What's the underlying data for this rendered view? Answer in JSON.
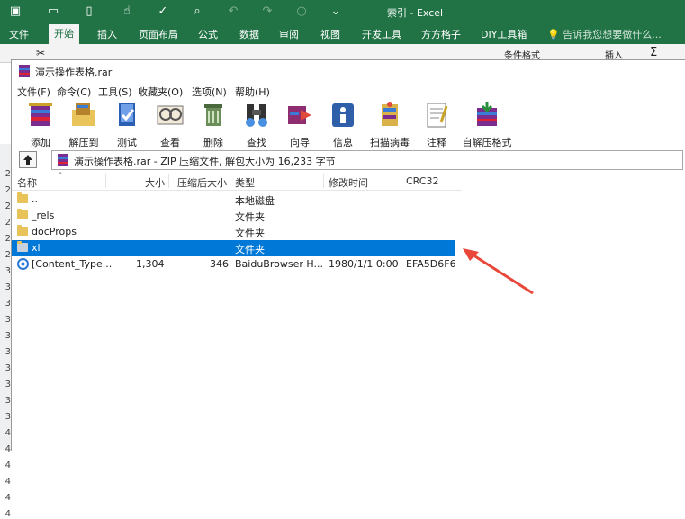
{
  "excel": {
    "title": "索引 - Excel",
    "tabs": [
      "文件",
      "开始",
      "插入",
      "页面布局",
      "公式",
      "数据",
      "审阅",
      "视图",
      "开发工具",
      "方方格子",
      "DIY工具箱"
    ],
    "active_tab": "开始",
    "search_hint": "告诉我您想要做什么...",
    "ribbon_items": [
      "条件格式",
      "插入"
    ],
    "row_numbers": [
      "2",
      "2",
      "2",
      "2",
      "2",
      "2",
      "3",
      "3",
      "3",
      "3",
      "3",
      "3",
      "3",
      "3",
      "3",
      "3",
      "4",
      "4",
      "4",
      "4",
      "4",
      "4"
    ]
  },
  "rar": {
    "title": "演示操作表格.rar",
    "menu": [
      "文件(F)",
      "命令(C)",
      "工具(S)",
      "收藏夹(O)",
      "选项(N)",
      "帮助(H)"
    ],
    "toolbar": [
      {
        "label": "添加",
        "icon": "add-icon"
      },
      {
        "label": "解压到",
        "icon": "extract-icon"
      },
      {
        "label": "测试",
        "icon": "test-icon"
      },
      {
        "label": "查看",
        "icon": "view-icon"
      },
      {
        "label": "删除",
        "icon": "delete-icon"
      },
      {
        "label": "查找",
        "icon": "find-icon"
      },
      {
        "label": "向导",
        "icon": "wizard-icon"
      },
      {
        "label": "信息",
        "icon": "info-icon"
      },
      {
        "label": "扫描病毒",
        "icon": "virus-scan-icon"
      },
      {
        "label": "注释",
        "icon": "comment-icon"
      },
      {
        "label": "自解压格式",
        "icon": "sfx-icon"
      }
    ],
    "address": "演示操作表格.rar - ZIP 压缩文件, 解包大小为 16,233 字节",
    "columns": [
      "名称",
      "大小",
      "压缩后大小",
      "类型",
      "修改时间",
      "CRC32"
    ],
    "rows": [
      {
        "name": "..",
        "size": "",
        "packed": "",
        "type": "本地磁盘",
        "modified": "",
        "crc": ""
      },
      {
        "name": "_rels",
        "size": "",
        "packed": "",
        "type": "文件夹",
        "modified": "",
        "crc": ""
      },
      {
        "name": "docProps",
        "size": "",
        "packed": "",
        "type": "文件夹",
        "modified": "",
        "crc": ""
      },
      {
        "name": "xl",
        "size": "",
        "packed": "",
        "type": "文件夹",
        "modified": "",
        "crc": "",
        "selected": true
      },
      {
        "name": "[Content_Type...",
        "size": "1,304",
        "packed": "346",
        "type": "BaiduBrowser H...",
        "modified": "1980/1/1 0:00",
        "crc": "EFA5D6F6"
      }
    ]
  },
  "colors": {
    "excel_green": "#217346",
    "selection": "#0078d7",
    "arrow": "#e8473a"
  }
}
